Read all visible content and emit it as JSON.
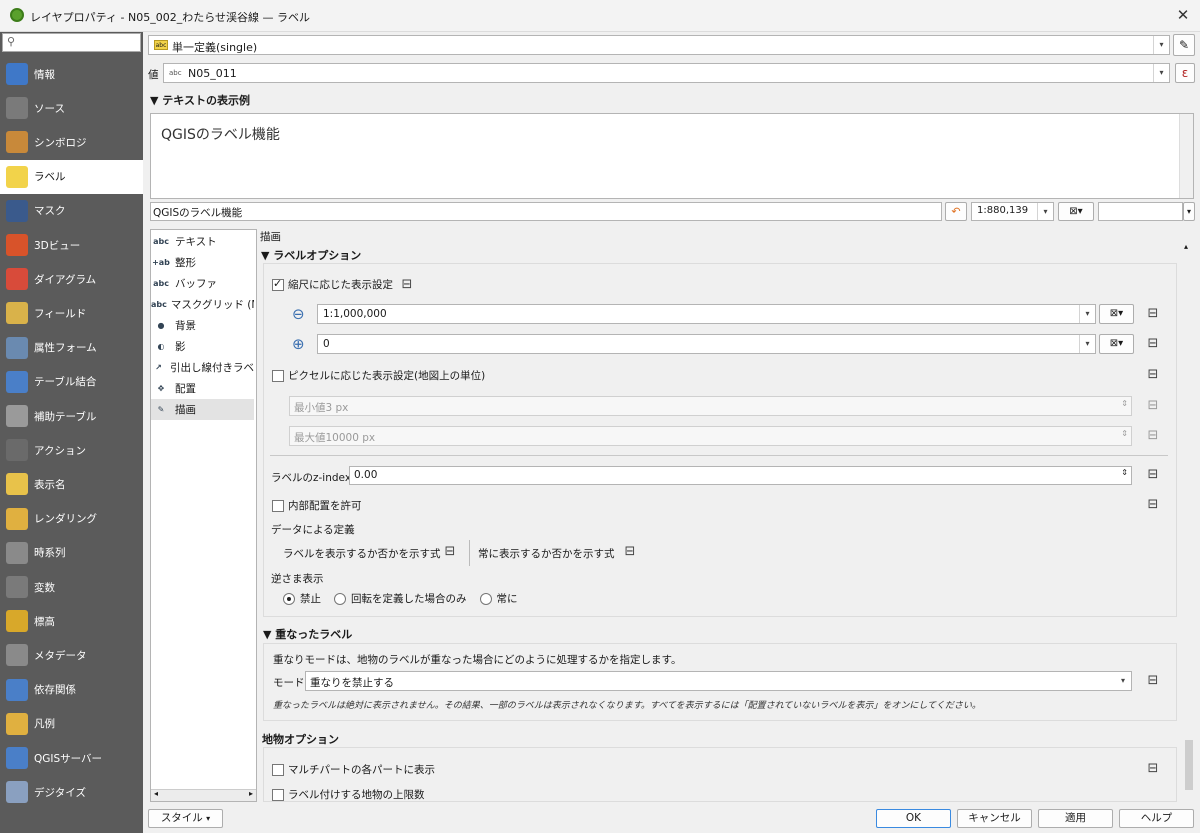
{
  "window": {
    "title": "レイヤプロパティ - N05_002_わたらせ渓谷線 — ラベル",
    "close": "✕"
  },
  "sidebar": {
    "search_icon": "⚲",
    "items": [
      {
        "label": "情報",
        "icon": "info-icon",
        "color": "#3f78c8"
      },
      {
        "label": "ソース",
        "icon": "source-icon",
        "color": "#7a7a7a"
      },
      {
        "label": "シンボロジ",
        "icon": "symbology-icon",
        "color": "#c8893a"
      },
      {
        "label": "ラベル",
        "icon": "label-icon",
        "color": "#f2d34a"
      },
      {
        "label": "マスク",
        "icon": "mask-icon",
        "color": "#3a5a8c"
      },
      {
        "label": "3Dビュー",
        "icon": "3d-icon",
        "color": "#d8532a"
      },
      {
        "label": "ダイアグラム",
        "icon": "diagram-icon",
        "color": "#d84b3a"
      },
      {
        "label": "フィールド",
        "icon": "fields-icon",
        "color": "#d9b24a"
      },
      {
        "label": "属性フォーム",
        "icon": "form-icon",
        "color": "#6a8ab0"
      },
      {
        "label": "テーブル結合",
        "icon": "join-icon",
        "color": "#4a7fc8"
      },
      {
        "label": "補助テーブル",
        "icon": "aux-table-icon",
        "color": "#9a9a9a"
      },
      {
        "label": "アクション",
        "icon": "action-icon",
        "color": "#6a6a6a"
      },
      {
        "label": "表示名",
        "icon": "display-icon",
        "color": "#e8c24a"
      },
      {
        "label": "レンダリング",
        "icon": "rendering-icon",
        "color": "#e0b040"
      },
      {
        "label": "時系列",
        "icon": "temporal-icon",
        "color": "#8a8a8a"
      },
      {
        "label": "変数",
        "icon": "variables-icon",
        "color": "#7a7a7a"
      },
      {
        "label": "標高",
        "icon": "elevation-icon",
        "color": "#d8a82a"
      },
      {
        "label": "メタデータ",
        "icon": "metadata-icon",
        "color": "#8a8a8a"
      },
      {
        "label": "依存関係",
        "icon": "dependencies-icon",
        "color": "#4a7fc8"
      },
      {
        "label": "凡例",
        "icon": "legend-icon",
        "color": "#e0b040"
      },
      {
        "label": "QGISサーバー",
        "icon": "server-icon",
        "color": "#4a7fc8"
      },
      {
        "label": "デジタイズ",
        "icon": "digitize-icon",
        "color": "#8aa0c0"
      }
    ]
  },
  "mode_combo": {
    "value": "単一定義(single)",
    "badge": "abc"
  },
  "value_row": {
    "label": "値",
    "badge": "abc",
    "value": "N05_011",
    "expr": "ε"
  },
  "preview_section": {
    "title": "テキストの表示例",
    "text": "QGISのラベル機能",
    "input": "QGISのラベル機能",
    "scale": "1:880,139"
  },
  "tab_list": [
    {
      "label": "テキスト",
      "icon": "abc"
    },
    {
      "label": "整形",
      "icon": "+ab"
    },
    {
      "label": "バッファ",
      "icon": "abc"
    },
    {
      "label": "マスクグリッド (M",
      "icon": "abc"
    },
    {
      "label": "背景",
      "icon": "●"
    },
    {
      "label": "影",
      "icon": "◐"
    },
    {
      "label": "引出し線付きラベ",
      "icon": "↗"
    },
    {
      "label": "配置",
      "icon": "✥"
    },
    {
      "label": "描画",
      "icon": "✎"
    }
  ],
  "render": {
    "heading": "描画",
    "label_options": "ラベルオプション",
    "scale_based": "縮尺に応じた表示設定",
    "min_scale": "1:1,000,000",
    "max_scale": "0",
    "pixel_based": "ピクセルに応じた表示設定(地図上の単位)",
    "min_px": "最小値3 px",
    "max_px": "最大値10000 px",
    "zindex_label": "ラベルのz-index",
    "zindex_value": "0.00",
    "inside_placement": "内部配置を許可",
    "data_defined": "データによる定義",
    "show_label": "ラベルを表示するか否かを示す式",
    "always_show": "常に表示するか否かを示す式",
    "upside_down": "逆さま表示",
    "radio_never": "禁止",
    "radio_defined": "回転を定義した場合のみ",
    "radio_always": "常に",
    "overlap_title": "重なったラベル",
    "overlap_desc": "重なりモードは、地物のラベルが重なった場合にどのように処理するかを指定します。",
    "mode_label": "モード",
    "mode_value": "重なりを禁止する",
    "overlap_note": "重なったラベルは絶対に表示されません。その結果、一部のラベルは表示されなくなります。すべてを表示するには「配置されていないラベルを表示」をオンにしてください。",
    "feature_options": "地物オプション",
    "multipart": "マルチパートの各パートに表示",
    "limit": "ラベル付けする地物の上限数"
  },
  "footer": {
    "style": "スタイル",
    "ok": "OK",
    "cancel": "キャンセル",
    "apply": "適用",
    "help": "ヘルプ"
  }
}
